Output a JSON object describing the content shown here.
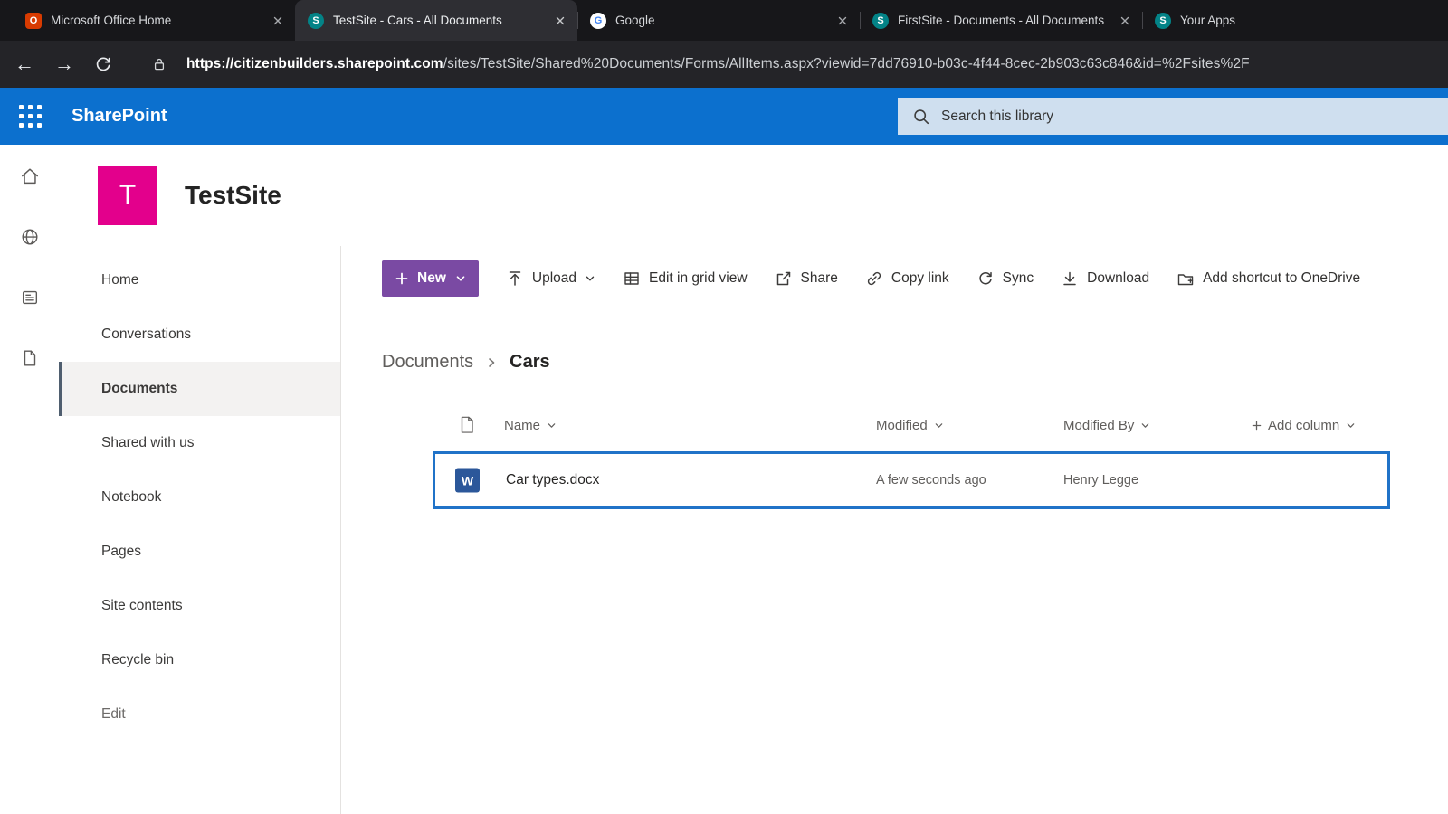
{
  "colors": {
    "suite_blue": "#0c70ce",
    "brand_pink": "#e3008c",
    "new_button_purple": "#7a4aa3",
    "selection_blue": "#2073c8",
    "nav_marker": "#4f5e6f"
  },
  "browser": {
    "tabs": [
      {
        "title": "Microsoft Office Home",
        "icon": "office-icon"
      },
      {
        "title": "TestSite - Cars - All Documents",
        "icon": "sharepoint-icon",
        "active": true
      },
      {
        "title": "Google",
        "icon": "google-icon"
      },
      {
        "title": "FirstSite - Documents - All Documents",
        "icon": "sharepoint-icon"
      },
      {
        "title": "Your Apps",
        "icon": "sharepoint-icon"
      }
    ],
    "url_domain": "https://citizenbuilders.sharepoint.com",
    "url_path": "/sites/TestSite/Shared%20Documents/Forms/AllItems.aspx?viewid=7dd76910-b03c-4f44-8cec-2b903c63c846&id=%2Fsites%2F"
  },
  "suite_bar": {
    "brand": "SharePoint",
    "search_placeholder": "Search this library"
  },
  "site": {
    "logo_letter": "T",
    "title": "TestSite"
  },
  "nav": {
    "items": [
      {
        "label": "Home"
      },
      {
        "label": "Conversations"
      },
      {
        "label": "Documents",
        "selected": true
      },
      {
        "label": "Shared with us"
      },
      {
        "label": "Notebook"
      },
      {
        "label": "Pages"
      },
      {
        "label": "Site contents"
      },
      {
        "label": "Recycle bin"
      },
      {
        "label": "Edit"
      }
    ]
  },
  "toolbar": {
    "new_label": "New",
    "actions": [
      {
        "label": "Upload",
        "icon": "upload-icon",
        "has_chevron": true
      },
      {
        "label": "Edit in grid view",
        "icon": "grid-icon"
      },
      {
        "label": "Share",
        "icon": "share-icon"
      },
      {
        "label": "Copy link",
        "icon": "copy-link-icon"
      },
      {
        "label": "Sync",
        "icon": "sync-icon"
      },
      {
        "label": "Download",
        "icon": "download-icon"
      },
      {
        "label": "Add shortcut to OneDrive",
        "icon": "add-shortcut-icon"
      }
    ]
  },
  "breadcrumb": {
    "parent": "Documents",
    "current": "Cars"
  },
  "library": {
    "columns": {
      "name": "Name",
      "modified": "Modified",
      "modified_by": "Modified By",
      "add_column": "Add column"
    },
    "rows": [
      {
        "name": "Car types.docx",
        "modified": "A few seconds ago",
        "modified_by": "Henry Legge",
        "file_type": "Word document",
        "word_badge": "W"
      }
    ]
  }
}
